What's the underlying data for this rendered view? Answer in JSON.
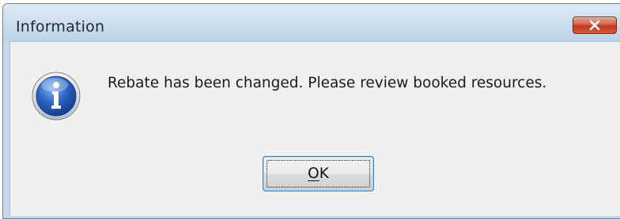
{
  "window": {
    "title": "Information",
    "close_icon": "close-icon"
  },
  "dialog": {
    "icon": "information-icon",
    "message": "Rebate has been changed. Please review booked resources.",
    "ok_button": {
      "mnemonic": "O",
      "rest": "K"
    }
  },
  "colors": {
    "frame": "#c4d8ea",
    "client": "#f0f0f0",
    "close_button": "#c7472d",
    "button_border": "#3c7fb1"
  }
}
